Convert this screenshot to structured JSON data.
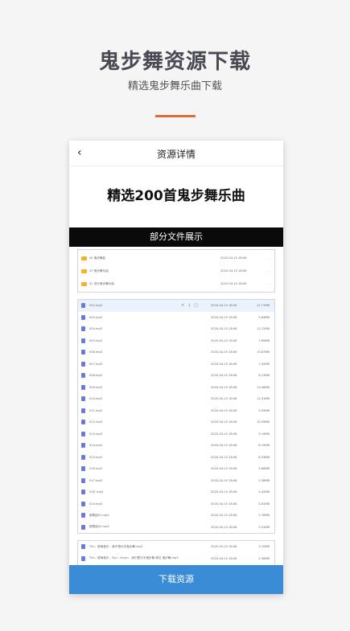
{
  "hero": {
    "title": "鬼步舞资源下载",
    "subtitle": "精选鬼步舞乐曲下载"
  },
  "colors": {
    "accent_bar": "#dd6b3b",
    "download_button": "#3a8bd6",
    "folder": "#f0b429",
    "file": "#6c79d8"
  },
  "screen": {
    "back_icon": "‹",
    "title": "资源详情",
    "headline": "精选200首鬼步舞乐曲",
    "section": "部分文件展示"
  },
  "folders": [
    {
      "name": "04 鬼步舞曲",
      "date": "2020-04-15 18:06",
      "size": "-"
    },
    {
      "name": "03 鬼步舞乐曲",
      "date": "2020-04-15 18:06",
      "size": "-"
    },
    {
      "name": "02 流行鬼步舞乐曲",
      "date": "2020-04-15 18:06",
      "size": "-"
    }
  ],
  "files": [
    {
      "name": "001.mp3",
      "date": "2020-04-15 18:06",
      "size": "12.77MB"
    },
    {
      "name": "002.mp3",
      "date": "2020-04-15 18:06",
      "size": "5.64MB"
    },
    {
      "name": "004.mp3",
      "date": "2020-04-15 18:06",
      "size": "12.12MB"
    },
    {
      "name": "005.mp3",
      "date": "2020-04-15 18:06",
      "size": "7.69MB"
    },
    {
      "name": "006.mp3",
      "date": "2020-04-15 18:06",
      "size": "13.87MB"
    },
    {
      "name": "007.mp3",
      "date": "2020-04-15 18:06",
      "size": "7.45MB"
    },
    {
      "name": "008.mp3",
      "date": "2020-04-15 18:06",
      "size": "8.13MB"
    },
    {
      "name": "009.mp3",
      "date": "2020-04-15 18:06",
      "size": "13.46MB"
    },
    {
      "name": "010.mp3",
      "date": "2020-04-15 18:06",
      "size": "12.31MB"
    },
    {
      "name": "011.mp3",
      "date": "2020-04-15 18:06",
      "size": "9.55MB"
    },
    {
      "name": "012.mp3",
      "date": "2020-04-15 18:06",
      "size": "10.59MB"
    },
    {
      "name": "013.mp3",
      "date": "2020-04-15 18:06",
      "size": "9.19MB"
    },
    {
      "name": "014.mp3",
      "date": "2020-04-15 18:06",
      "size": "8.15MB"
    },
    {
      "name": "015.mp3",
      "date": "2020-04-15 18:06",
      "size": "8.53MB"
    },
    {
      "name": "016.mp3",
      "date": "2020-04-15 18:06",
      "size": "4.88MB"
    },
    {
      "name": "017.mp3",
      "date": "2020-04-15 18:06",
      "size": "2.58MB"
    },
    {
      "name": "018 .mp3",
      "date": "2020-04-15 18:06",
      "size": "4.42MB"
    },
    {
      "name": "019.mp3",
      "date": "2020-04-15 18:06",
      "size": "4.61MB"
    },
    {
      "name": "新歌曲01.mp3",
      "date": "2020-04-15 18:06",
      "size": "2.78MB"
    },
    {
      "name": "新歌曲02.mp3",
      "date": "2020-04-15 18:06",
      "size": "5.31MB"
    }
  ],
  "file_actions": [
    "share-icon",
    "download-icon",
    "delete-icon"
  ],
  "more_files": [
    {
      "name": "Tim、玻璃音乐 - 我不想分手鬼步舞.mp3",
      "date": "2020-04-15 18:06",
      "size": "3.10MB"
    },
    {
      "name": "Tim、玻璃音乐、Syn - Anym - 我们是分手鬼步舞 单位 鬼步舞.mp3",
      "date": "2020-04-15 18:06",
      "size": "2.38MB"
    }
  ],
  "download_label": "下载资源"
}
